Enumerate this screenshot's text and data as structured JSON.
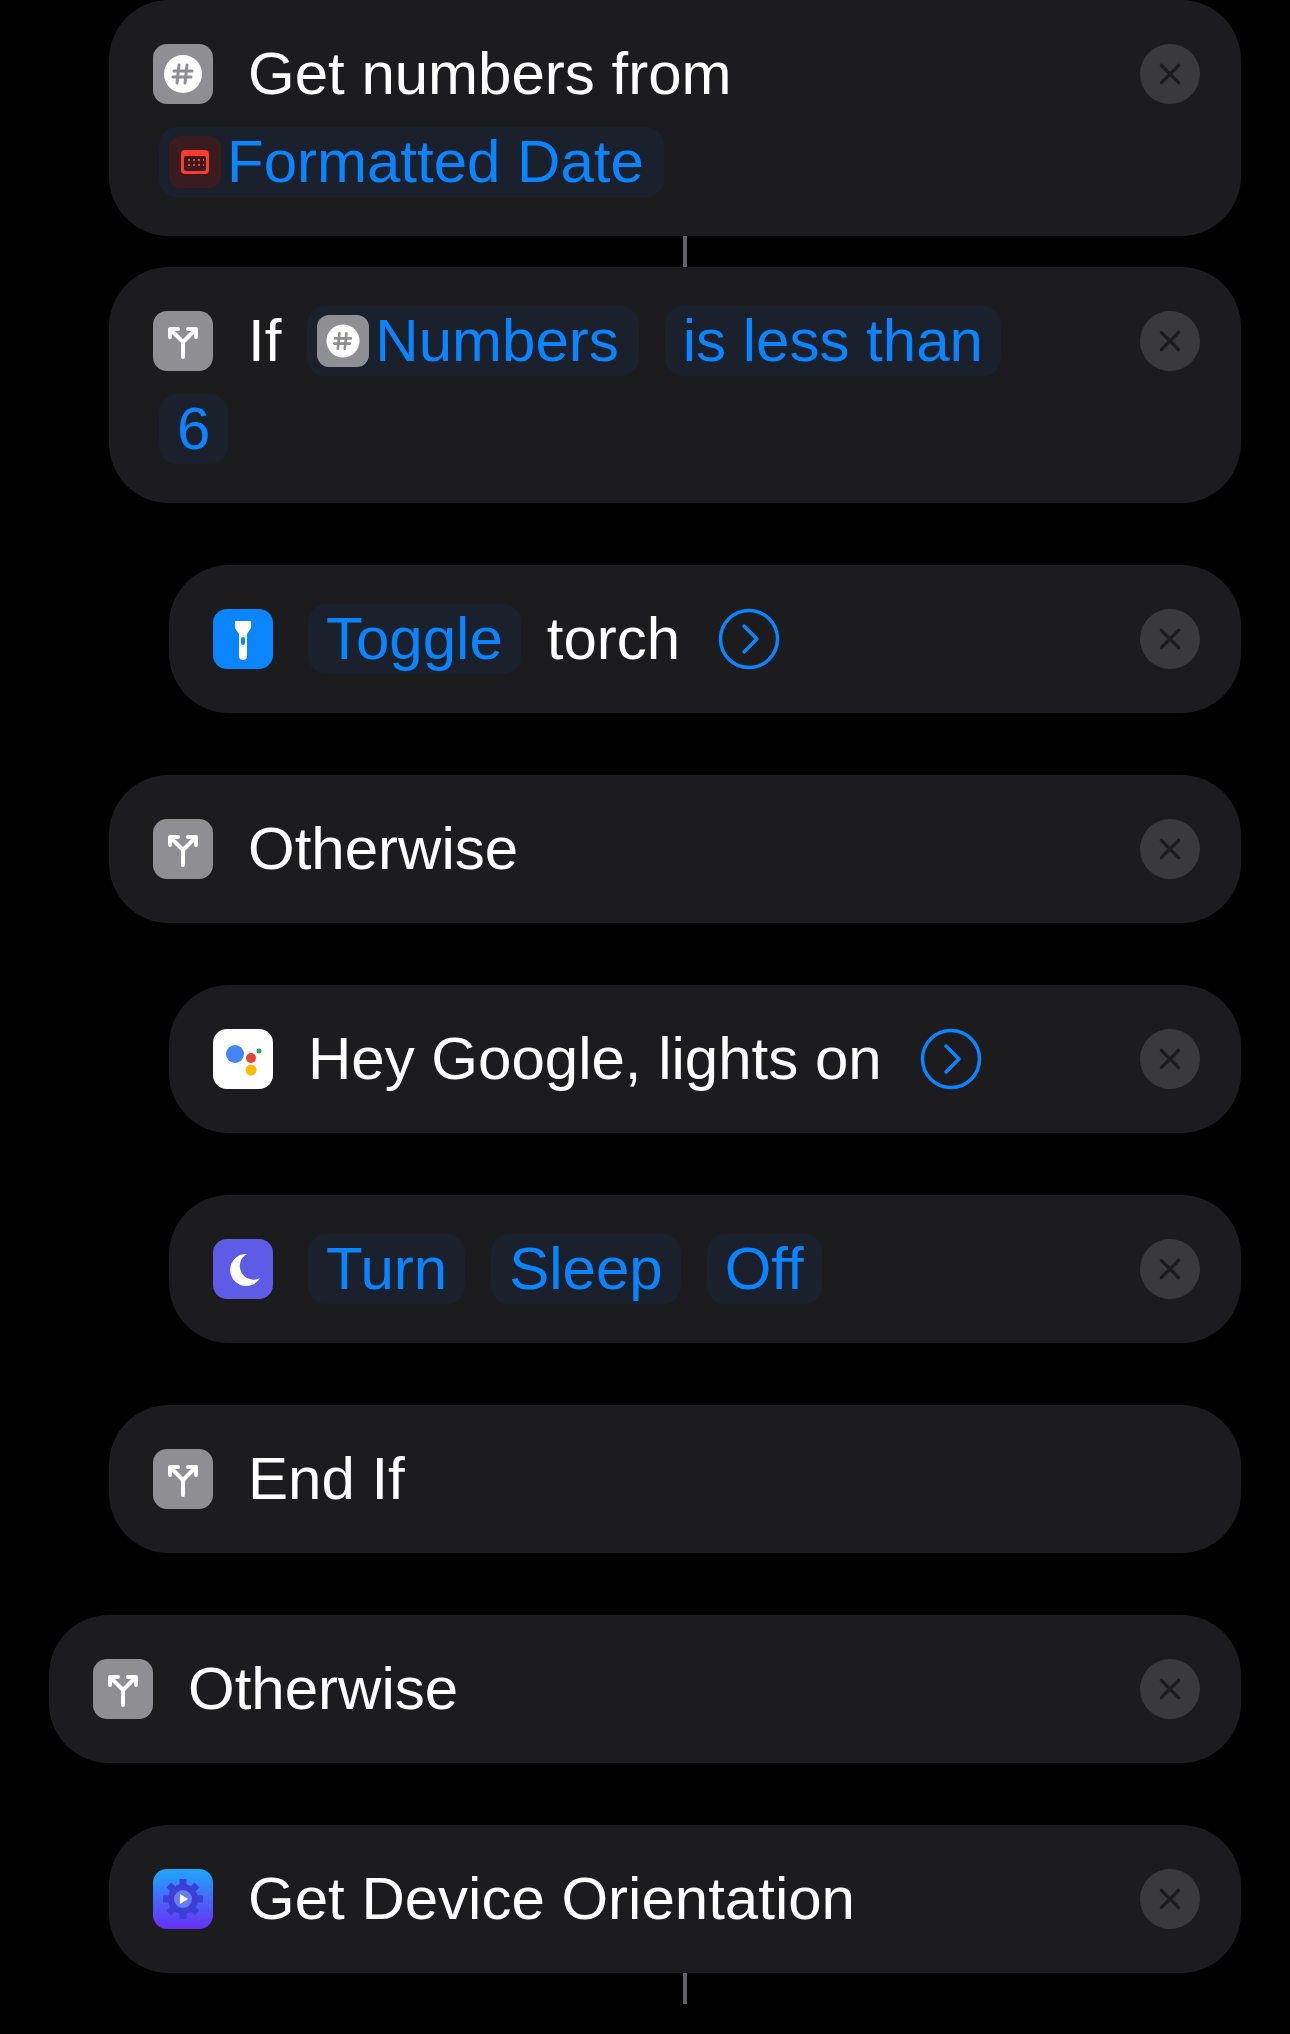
{
  "actions": [
    {
      "kind": "group",
      "children": [
        {
          "kind": "get_numbers",
          "removable": true,
          "connector_after": true,
          "lines": [
            [
              {
                "kind": "text",
                "text": "Get numbers from"
              }
            ],
            [
              {
                "kind": "date_variable",
                "text": "Formatted Date"
              }
            ]
          ]
        },
        {
          "kind": "if",
          "removable": true,
          "connector_after": false,
          "lines": [
            [
              {
                "kind": "text",
                "text": "If"
              },
              {
                "kind": "number_variable",
                "text": "Numbers"
              },
              {
                "kind": "token",
                "text": "is less than"
              }
            ],
            [
              {
                "kind": "token",
                "text": "6"
              }
            ]
          ],
          "children": [
            {
              "kind": "flashlight",
              "removable": true,
              "connector_after": false,
              "lines": [
                [
                  {
                    "kind": "token",
                    "text": "Toggle"
                  },
                  {
                    "kind": "text",
                    "text": "torch"
                  },
                  {
                    "kind": "chevron"
                  }
                ]
              ]
            }
          ]
        },
        {
          "kind": "otherwise",
          "removable": true,
          "connector_after": false,
          "lines": [
            [
              {
                "kind": "text",
                "text": "Otherwise"
              }
            ]
          ],
          "children": [
            {
              "kind": "assistant",
              "removable": true,
              "connector_after": false,
              "lines": [
                [
                  {
                    "kind": "text",
                    "text": "Hey Google, lights on"
                  },
                  {
                    "kind": "chevron"
                  }
                ]
              ]
            },
            {
              "kind": "sleep",
              "removable": true,
              "connector_after": false,
              "lines": [
                [
                  {
                    "kind": "token",
                    "text": "Turn"
                  },
                  {
                    "kind": "token",
                    "text": "Sleep"
                  },
                  {
                    "kind": "token",
                    "text": "Off"
                  }
                ]
              ]
            }
          ]
        },
        {
          "kind": "end_if",
          "removable": false,
          "connector_after": false,
          "lines": [
            [
              {
                "kind": "text",
                "text": "End If"
              }
            ]
          ]
        }
      ]
    },
    {
      "kind": "otherwise",
      "removable": true,
      "connector_after": false,
      "lines": [
        [
          {
            "kind": "text",
            "text": "Otherwise"
          }
        ]
      ],
      "children": [
        {
          "kind": "orientation",
          "removable": true,
          "connector_after": true,
          "lines": [
            [
              {
                "kind": "text",
                "text": "Get Device Orientation"
              }
            ]
          ]
        }
      ]
    }
  ]
}
